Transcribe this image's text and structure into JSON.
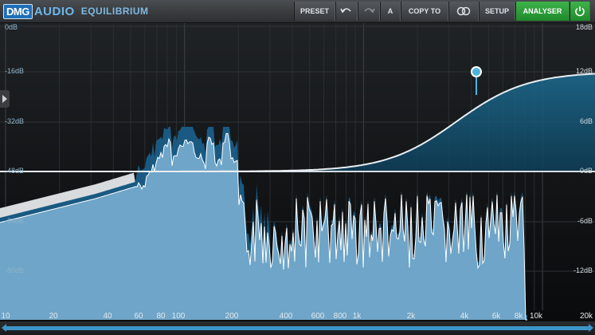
{
  "toolbar": {
    "logo_dmg": "DMG",
    "logo_audio": "AUDIO",
    "product": "EQUILIBRIUM",
    "preset": "PRESET",
    "ab": "A",
    "copy_to": "COPY TO",
    "setup": "SETUP",
    "analyser": "ANALYSER"
  },
  "graph": {
    "left_db_labels": [
      "0dB",
      "-16dB",
      "-32dB",
      "-48dB",
      "-64dB",
      "-80dB"
    ],
    "right_db_labels": [
      "18dB",
      "12dB",
      "6dB",
      "0dB",
      "-6dB",
      "-12dB"
    ],
    "freq_labels": [
      "10",
      "20",
      "40",
      "60",
      "80",
      "100",
      "200",
      "400",
      "600",
      "800",
      "1k",
      "2k",
      "4k",
      "6k",
      "8k",
      "10k",
      "20k"
    ],
    "filter_node": {
      "frequency_label": "4k",
      "gain_db": 12
    }
  },
  "colors": {
    "accent": "#4fb3e0",
    "spectrum": "#6ea5c8",
    "spectrum_dark": "#1a5a82",
    "analyser_on": "#2fa23c"
  }
}
